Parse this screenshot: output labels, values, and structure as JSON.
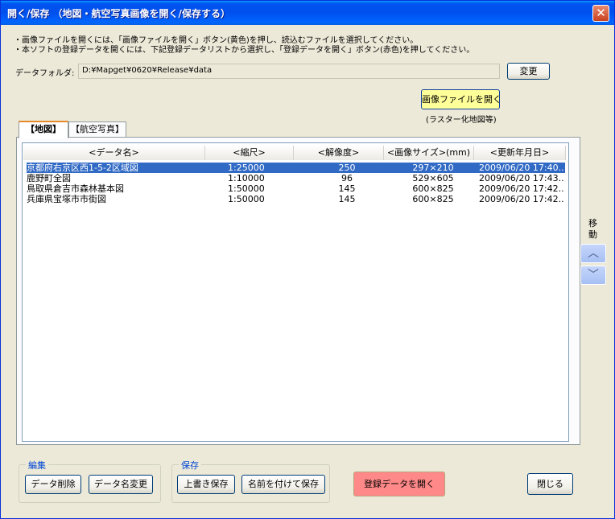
{
  "window": {
    "title": "開く/保存 （地図・航空写真画像を開く/保存する）",
    "close_glyph": "✕"
  },
  "instructions": {
    "line1": "・画像ファイルを開くには、「画像ファイルを開く」ボタン(黄色)を押し、読込むファイルを選択してください。",
    "line2": "・本ソフトの登録データを開くには、下記登録データリストから選択し、「登録データを開く」ボタン(赤色)を押してください。"
  },
  "folder": {
    "label": "データフォルダ:",
    "value": "D:¥Mapget¥0620¥Release¥data",
    "change_button": "変更"
  },
  "open_image": {
    "button": "画像ファイルを開く",
    "note": "(ラスター化地図等)"
  },
  "tabs": [
    {
      "label": "【地図】",
      "active": true
    },
    {
      "label": "【航空写真】",
      "active": false
    }
  ],
  "table": {
    "columns": [
      "<データ名>",
      "<縮尺>",
      "<解像度>",
      "<画像サイズ>(mm)",
      "<更新年月日>"
    ],
    "rows": [
      {
        "name": "京都府右京区西1-5-2区域図",
        "scale": "1:25000",
        "res": "250",
        "size": "297×210",
        "date": "2009/06/20 17:40..."
      },
      {
        "name": "鹿野町全図",
        "scale": "1:10000",
        "res": "96",
        "size": "529×605",
        "date": "2009/06/20 17:43..."
      },
      {
        "name": "鳥取県倉吉市森林基本図",
        "scale": "1:50000",
        "res": "145",
        "size": "600×825",
        "date": "2009/06/20 17:42..."
      },
      {
        "name": "兵庫県宝塚市市街図",
        "scale": "1:50000",
        "res": "145",
        "size": "600×825",
        "date": "2009/06/20 17:42..."
      }
    ],
    "selected_row": 0
  },
  "move": {
    "label1": "移",
    "label2": "動",
    "up_glyph": "︿",
    "down_glyph": "﹀"
  },
  "edit_group": {
    "title": "編集",
    "delete_button": "データ削除",
    "rename_button": "データ名変更"
  },
  "save_group": {
    "title": "保存",
    "overwrite_button": "上書き保存",
    "save_as_button": "名前を付けて保存"
  },
  "open_registered_button": "登録データを開く",
  "close_button": "閉じる",
  "colors": {
    "title_bar": "#0053ee",
    "selection": "#316ac5",
    "yellow_button": "#ffff99",
    "red_button": "#ff8888"
  }
}
